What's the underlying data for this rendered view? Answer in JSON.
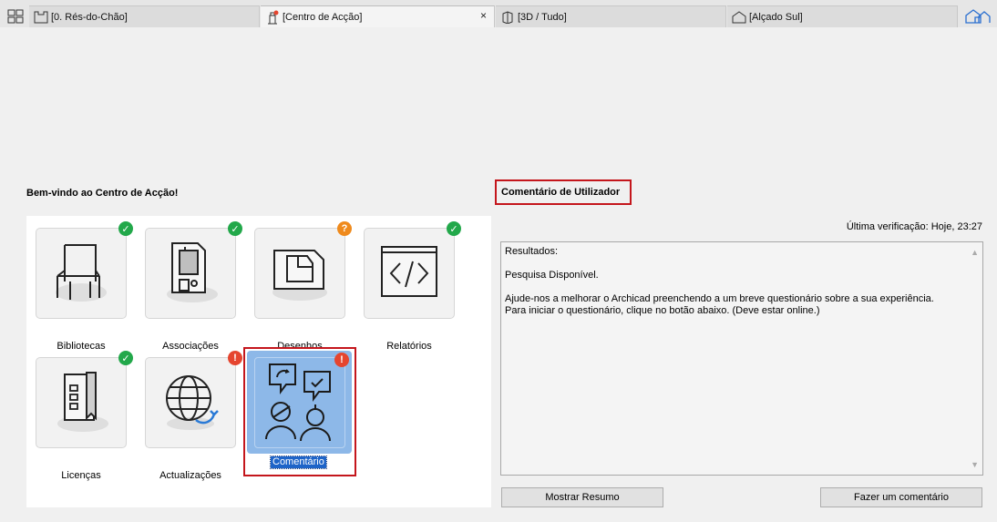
{
  "tabs": [
    {
      "label": "[0. Rés-do-Chão]",
      "icon": "floor-plan-icon"
    },
    {
      "label": "[Centro de Acção]",
      "icon": "action-center-icon",
      "active": true
    },
    {
      "label": "[3D / Tudo]",
      "icon": "3d-view-icon"
    },
    {
      "label": "[Alçado Sul]",
      "icon": "elevation-icon"
    }
  ],
  "tab_close": "×",
  "welcome_title": "Bem-vindo ao Centro de Acção!",
  "tiles": [
    {
      "label": "Bibliotecas",
      "icon": "chair-icon",
      "status": "ok"
    },
    {
      "label": "Associações",
      "icon": "document-attachments-icon",
      "status": "ok"
    },
    {
      "label": "Desenhos",
      "icon": "drawing-icon",
      "status": "warn"
    },
    {
      "label": "Relatórios",
      "icon": "code-report-icon",
      "status": "ok"
    },
    {
      "label": "Licenças",
      "icon": "license-icon",
      "status": "ok"
    },
    {
      "label": "Actualizações",
      "icon": "globe-update-icon",
      "status": "alert"
    },
    {
      "label": "Comentário",
      "icon": "feedback-icon",
      "status": "alert",
      "selected": true
    }
  ],
  "badges": {
    "ok": "✓",
    "warn": "?",
    "alert": "!"
  },
  "feedback": {
    "title": "Comentário de Utilizador",
    "last_check": "Última verificação: Hoje, 23:27",
    "results_heading": "Resultados:",
    "survey_status": "Pesquisa Disponível.",
    "message_line1": "Ajude-nos a melhorar o Archicad preenchendo a um breve questionário sobre a sua experiência.",
    "message_line2": "Para iniciar o questionário, clique no botão abaixo. (Deve estar online.)"
  },
  "buttons": {
    "show_summary": "Mostrar Resumo",
    "give_feedback": "Fazer um comentário"
  },
  "colors": {
    "ok": "#22a84a",
    "warn": "#ef8a1c",
    "alert": "#e5452f",
    "highlight": "#c4161c",
    "selection": "#8db8e8"
  }
}
